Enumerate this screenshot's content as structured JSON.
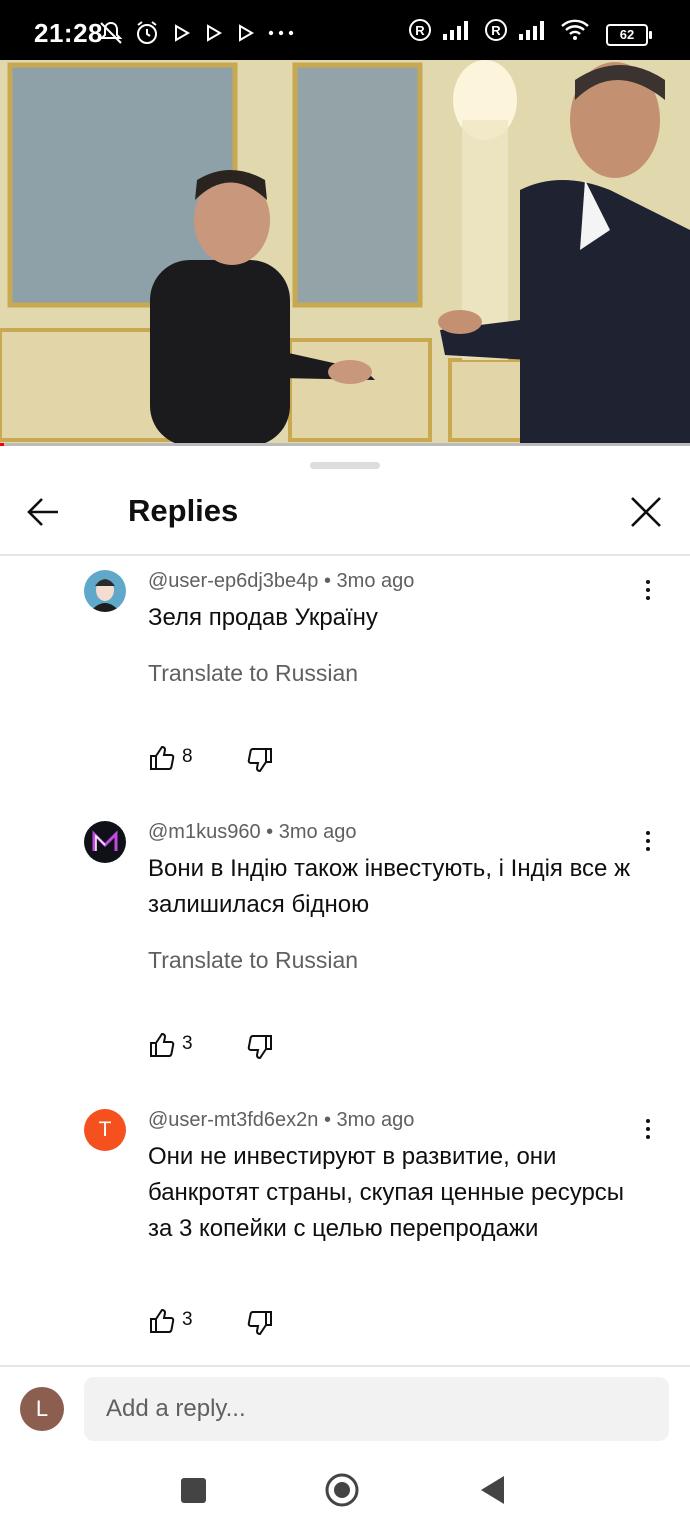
{
  "status_bar": {
    "time": "21:28",
    "battery": "62"
  },
  "header": {
    "title": "Replies"
  },
  "comments": [
    {
      "handle": "@user-ep6dj3be4p",
      "age": "3mo ago",
      "text": "Зеля продав Україну",
      "translate": "Translate to Russian",
      "likes": "8",
      "avatar": "portrait-avatar"
    },
    {
      "handle": "@m1kus960",
      "age": "3mo ago",
      "text": "Вони в Індію також інвестують, і Індія все ж залишилася бідною",
      "translate": "Translate to Russian",
      "likes": "3",
      "avatar": "m-logo-avatar"
    },
    {
      "handle": "@user-mt3fd6ex2n",
      "age": "3mo ago",
      "text": "Они не инвестируют в развитие, они банкротят страны, скупая ценные ресурсы за 3 копейки с целью перепродажи",
      "likes": "3",
      "avatar_letter": "T",
      "avatar_color": "#f4511e"
    }
  ],
  "reply_bar": {
    "avatar_letter": "L",
    "avatar_color": "#8b5e4f",
    "placeholder": "Add a reply..."
  },
  "icons": [
    "back-arrow-icon",
    "close-icon",
    "more-vert-icon",
    "thumbs-up-icon",
    "thumbs-down-icon"
  ]
}
